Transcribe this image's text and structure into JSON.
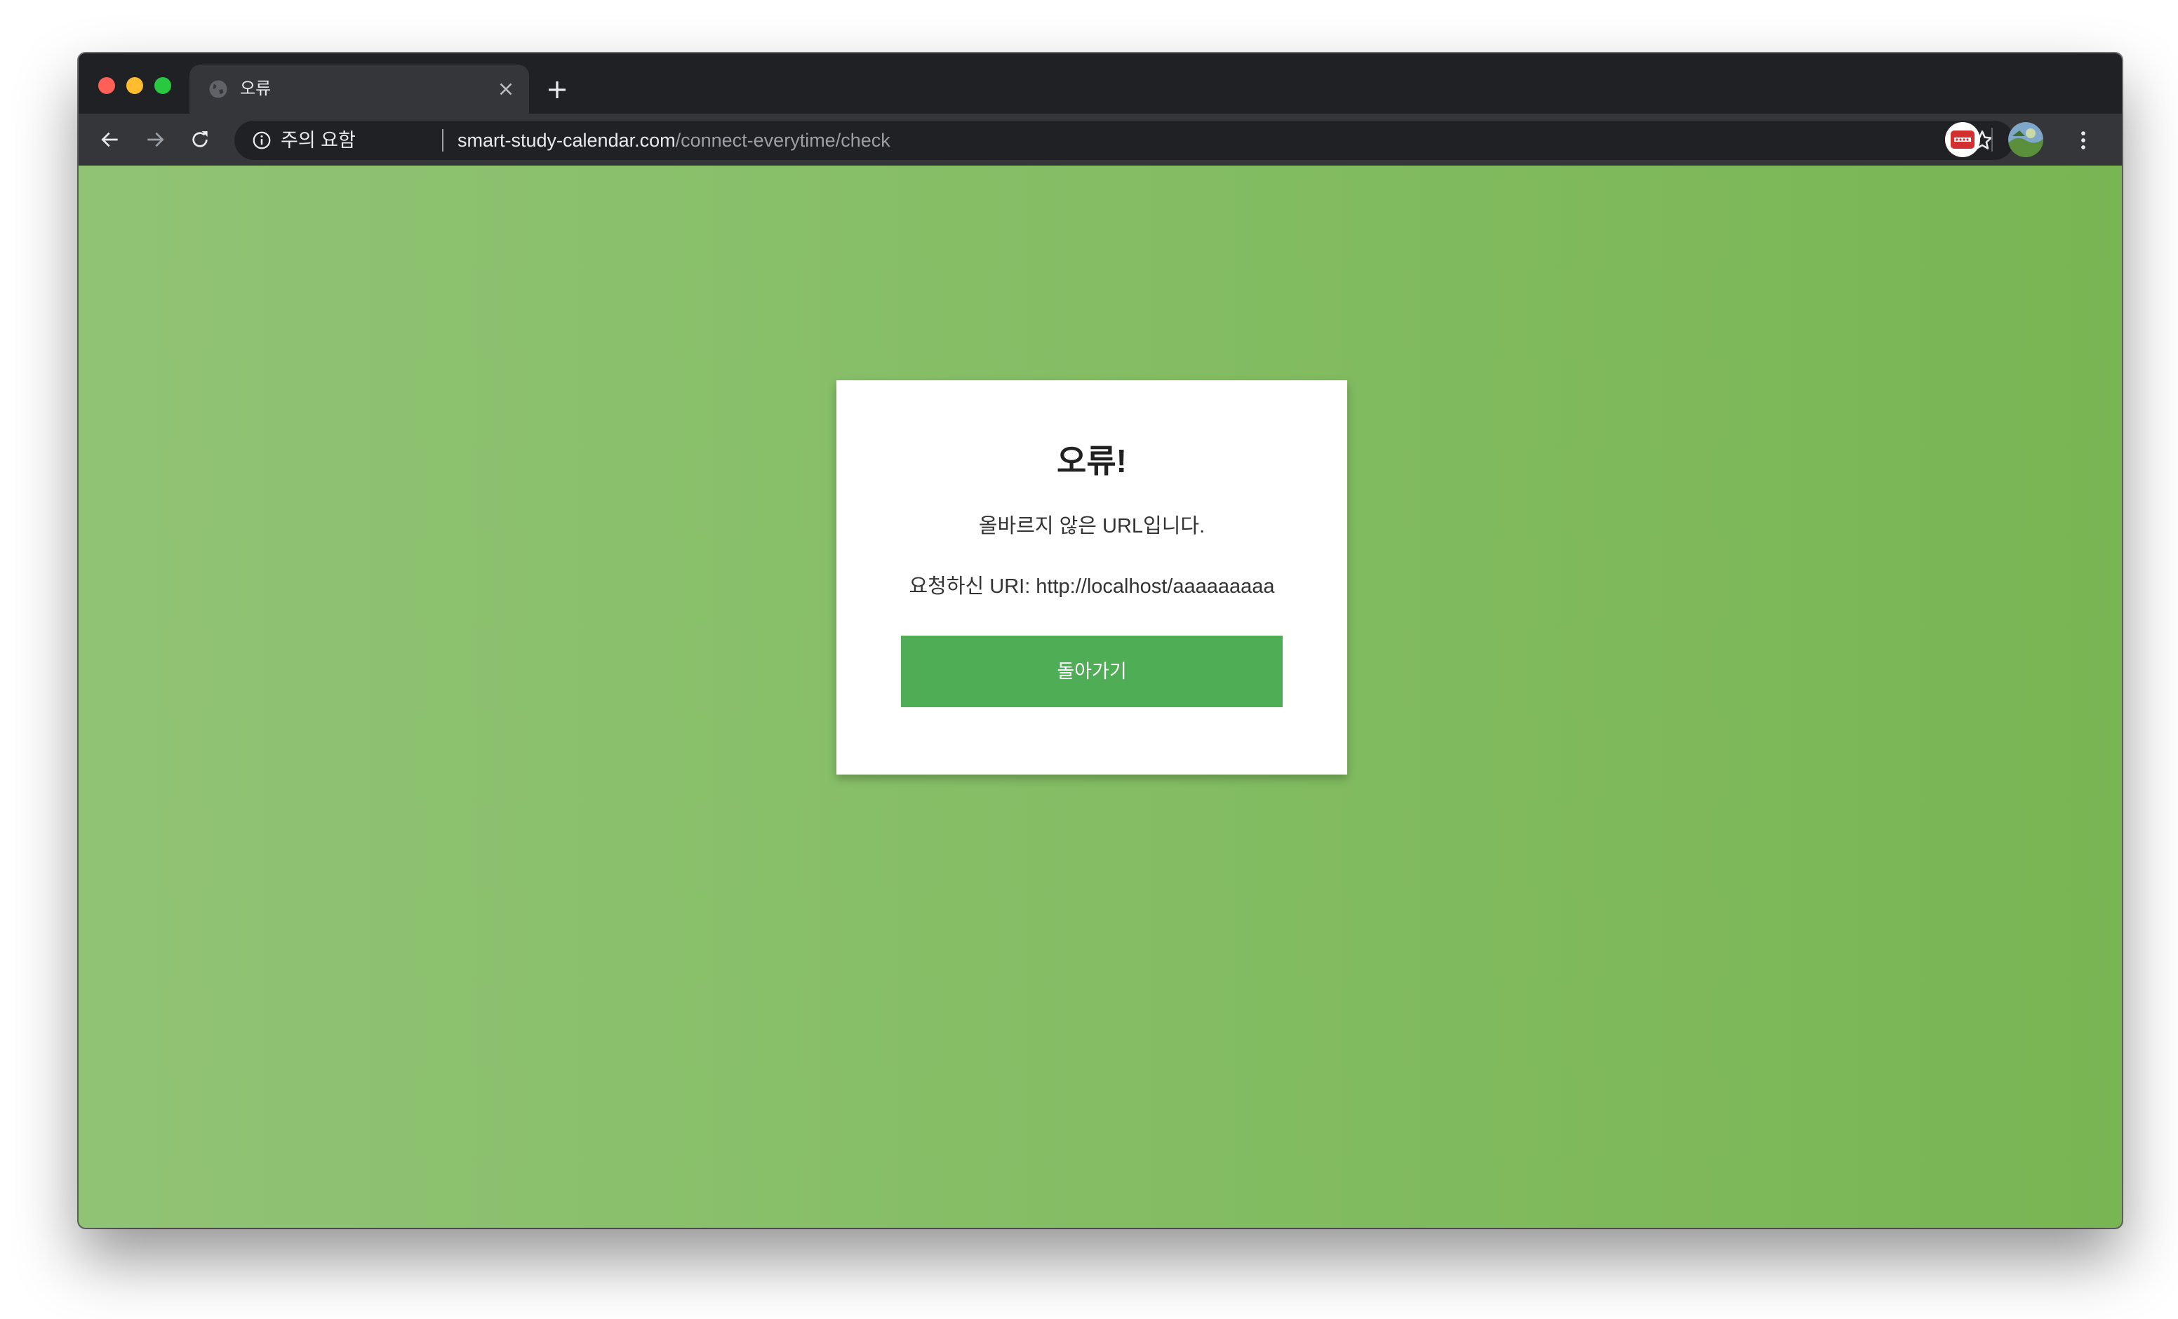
{
  "browser": {
    "tab": {
      "title": "오류"
    },
    "address_bar": {
      "security_label": "주의 요함",
      "url_host": "smart-study-calendar.com",
      "url_path": "/connect-everytime/check"
    }
  },
  "page": {
    "title": "오류!",
    "message": "올바르지 않은 URL입니다.",
    "requested_uri": "요청하신 URI: http://localhost/aaaaaaaaa",
    "back_button_label": "돌아가기"
  },
  "colors": {
    "background_gradient": [
      "#91c374",
      "#79b553"
    ],
    "button": "#4fad55"
  }
}
